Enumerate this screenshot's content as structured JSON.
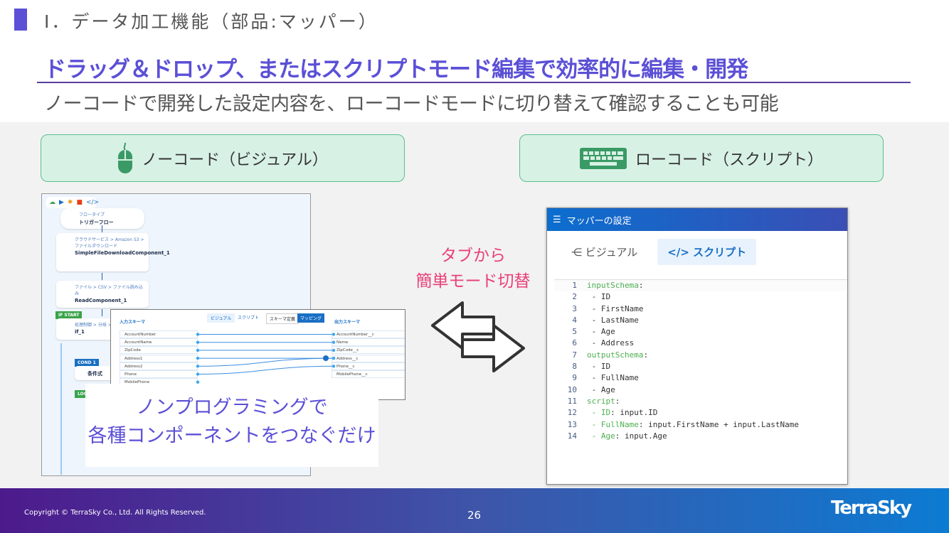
{
  "header": {
    "section": "Ⅰ．データ加工機能（部品:マッパー）",
    "headline": "ドラッグ＆ドロップ、またはスクリプトモード編集で効率的に編集・開発",
    "subtitle": "ノーコードで開発した設定内容を、ローコードモードに切り替えて確認することも可能"
  },
  "colors": {
    "accent": "#5b50d6",
    "callout_pink": "#e8407a",
    "green_box": "#d8f1e5"
  },
  "nocode": {
    "label": "ノーコード（ビジュアル）",
    "icon": "mouse-icon"
  },
  "lowcode": {
    "label": "ローコード（スクリプト）",
    "icon": "keyboard-icon"
  },
  "flow": {
    "trigger": {
      "type": "フロータイプ",
      "name": "トリガーフロー"
    },
    "nodes": [
      {
        "path": "クラウドサービス > Amazon S3 > ファイルダウンロード",
        "name": "SimpleFileDownloadComponent_1"
      },
      {
        "path": "ファイル > CSV > ファイル読み込み",
        "name": "ReadComponent_1"
      },
      {
        "path": "処理制御 > 分岐 > 条件分岐",
        "name": "if_1"
      }
    ],
    "if_tag": "IF START",
    "cond_tag": "COND 1",
    "cond_label": "条件式",
    "loop_tag": "LOOP"
  },
  "mapping": {
    "input_title": "入力スキーマ",
    "output_title": "出力スキーマ",
    "tabs": [
      "ビジュアル",
      "スクリプト"
    ],
    "modes": [
      "スキーマ定義",
      "マッピング"
    ],
    "inputs": [
      "AccountNumber",
      "AccountName",
      "ZipCode",
      "Address1",
      "Address2",
      "Phone",
      "MobilePhone"
    ],
    "outputs": [
      "AccountNumber__c",
      "Name",
      "ZipCode__c",
      "Address__c",
      "Phone__c",
      "MobilePhone__c"
    ]
  },
  "callout": {
    "line1": "ノンプログラミングで",
    "line2": "各種コンポーネントをつなぐだけ"
  },
  "switch_note": {
    "line1": "タブから",
    "line2": "簡単モード切替"
  },
  "script_panel": {
    "title": "マッパーの設定",
    "tabs": [
      "ビジュアル",
      "スクリプト"
    ],
    "active_tab": "スクリプト",
    "lines": [
      {
        "n": "1",
        "k": "inputSchema",
        "r": ":"
      },
      {
        "n": "2",
        "k": "",
        "r": " - ID"
      },
      {
        "n": "3",
        "k": "",
        "r": " - FirstName"
      },
      {
        "n": "4",
        "k": "",
        "r": " - LastName"
      },
      {
        "n": "5",
        "k": "",
        "r": " - Age"
      },
      {
        "n": "6",
        "k": "",
        "r": " - Address"
      },
      {
        "n": "7",
        "k": "outputSchema",
        "r": ":"
      },
      {
        "n": "8",
        "k": "",
        "r": " - ID"
      },
      {
        "n": "9",
        "k": "",
        "r": " - FullName"
      },
      {
        "n": "10",
        "k": "",
        "r": " - Age"
      },
      {
        "n": "11",
        "k": "script",
        "r": ":"
      },
      {
        "n": "12",
        "k": " - ID",
        "r": ": input.ID"
      },
      {
        "n": "13",
        "k": " - FullName",
        "r": ": input.FirstName + input.LastName"
      },
      {
        "n": "14",
        "k": " - Age",
        "r": ": input.Age"
      }
    ]
  },
  "footer": {
    "copyright": "Copyright © TerraSky Co., Ltd. All Rights Reserved.",
    "page": "26",
    "logo": "TerraSky"
  }
}
